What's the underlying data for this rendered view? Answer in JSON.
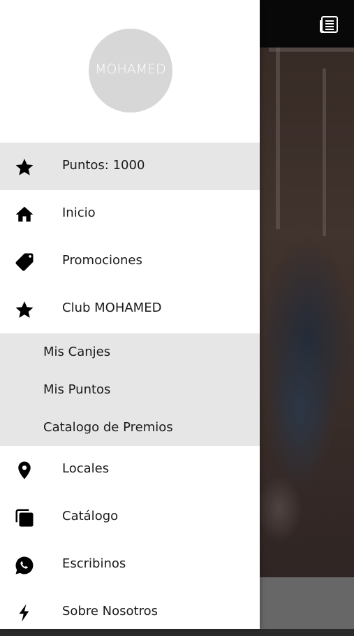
{
  "brand": {
    "logo_text": "MOHAMED"
  },
  "header": {
    "icon": "newspaper-icon"
  },
  "menu": {
    "points": {
      "label": "Puntos: 1000",
      "icon": "star-icon"
    },
    "items": [
      {
        "label": "Inicio",
        "icon": "home-icon"
      },
      {
        "label": "Promociones",
        "icon": "tag-icon"
      },
      {
        "label": "Club MOHAMED",
        "icon": "star-icon"
      }
    ],
    "club_submenu": [
      {
        "label": "Mis Canjes"
      },
      {
        "label": "Mis Puntos"
      },
      {
        "label": "Catalogo de Premios"
      }
    ],
    "more_items": [
      {
        "label": "Locales",
        "icon": "map-pin-icon"
      },
      {
        "label": "Catálogo",
        "icon": "catalog-icon"
      },
      {
        "label": "Escribinos",
        "icon": "whatsapp-icon"
      },
      {
        "label": "Sobre Nosotros",
        "icon": "bolt-icon"
      }
    ]
  },
  "colors": {
    "highlight": "#e6e6e6",
    "drawer_bg": "#ffffff",
    "topbar": "#0b0b0b",
    "logo_circle": "#d7d7d7"
  }
}
